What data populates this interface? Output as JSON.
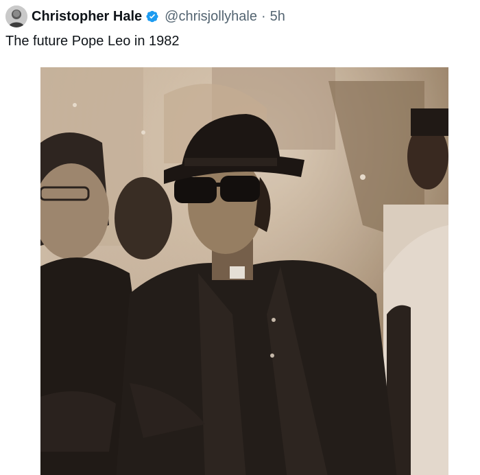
{
  "tweet": {
    "author": {
      "display_name": "Christopher Hale",
      "handle": "@chrisjollyhale",
      "verified_icon": "verified-badge-icon",
      "avatar_icon": "avatar"
    },
    "separator": "·",
    "timestamp": "5h",
    "text": "The future Pope Leo in 1982",
    "media": {
      "description_icon": "photo",
      "colors": {
        "sepia_light": "#d8c7b2",
        "sepia_mid": "#a8927a",
        "dark_coat": "#231d19"
      }
    }
  },
  "colors": {
    "primary_text": "#0f1419",
    "secondary_text": "#536471",
    "verified_blue": "#1d9bf0",
    "background": "#ffffff"
  }
}
